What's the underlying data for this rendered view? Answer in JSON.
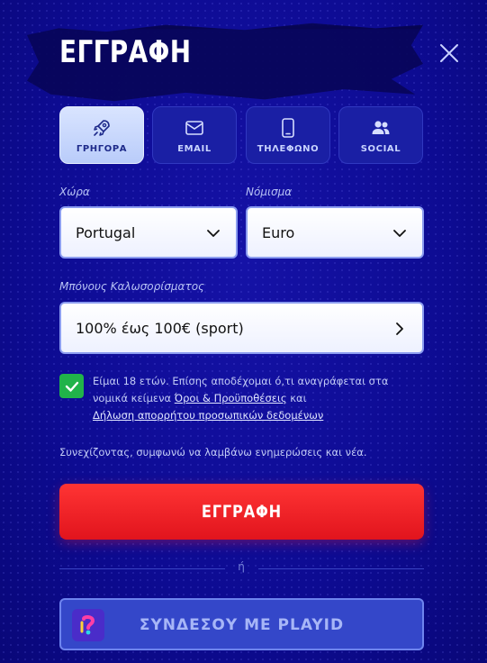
{
  "header": {
    "title": "ΕΓΓΡΑΦΗ",
    "close_icon": "close-icon"
  },
  "tabs": [
    {
      "label": "ΓΡΗΓΟΡΑ",
      "icon": "rocket-icon",
      "active": true
    },
    {
      "label": "EMAIL",
      "icon": "mail-icon",
      "active": false
    },
    {
      "label": "ΤΗΛΕΦΩΝΟ",
      "icon": "phone-icon",
      "active": false
    },
    {
      "label": "SOCIAL",
      "icon": "users-icon",
      "active": false
    }
  ],
  "country": {
    "label": "Χώρα",
    "value": "Portugal"
  },
  "currency": {
    "label": "Νόμισμα",
    "value": "Euro"
  },
  "bonus": {
    "label": "Μπόνους Καλωσορίσματος",
    "value": "100% έως 100€ (sport)"
  },
  "terms": {
    "checked": true,
    "text_before": "Είμαι 18 ετών. Επίσης αποδέχομαι ό,τι αναγράφεται στα νομικά κείμενα ",
    "link_terms": "Όροι & Προϋποθέσεις",
    "text_middle": " και",
    "link_privacy": "Δήλωση απορρήτου προσωπικών δεδομένων"
  },
  "newsletter_text": "Συνεχίζοντας, συμφωνώ να λαμβάνω ενημερώσεις και νέα.",
  "submit_label": "ΕΓΓΡΑΦΗ",
  "divider_text": "ή",
  "playid_label": "ΣΥΝΔΕΣΟΥ ΜΕ PLAYID",
  "colors": {
    "background": "#0d0b92",
    "accent_red": "#e1141d",
    "check_green": "#21b34a",
    "tab_active": "#c9d8fc"
  }
}
